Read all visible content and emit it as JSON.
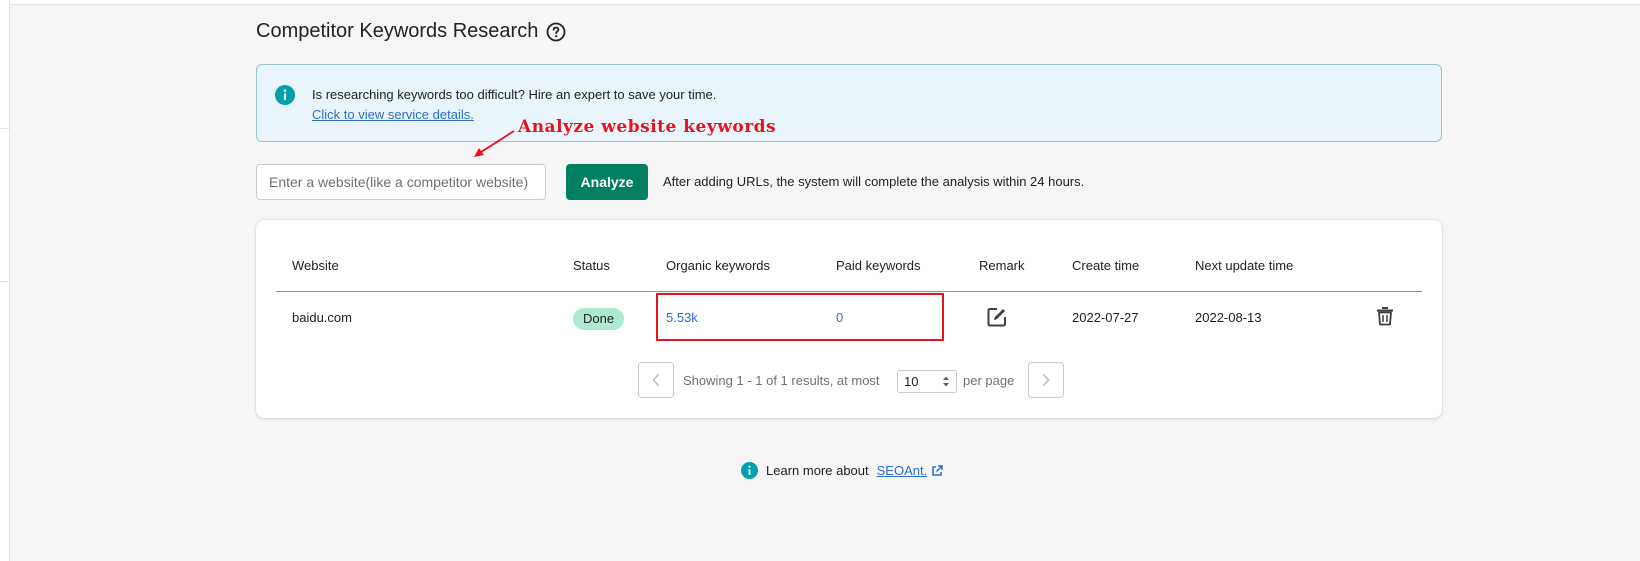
{
  "page": {
    "title": "Competitor Keywords Research"
  },
  "banner": {
    "message": "Is researching keywords too difficult? Hire an expert to save your time.",
    "link_text": "Click to view service details."
  },
  "annotation": {
    "label": "Analyze website keywords",
    "color": "#e8111c"
  },
  "analyze_form": {
    "placeholder": "Enter a website(like a competitor website)",
    "value": "",
    "button_label": "Analyze",
    "note": "After adding URLs, the system will complete the analysis within 24 hours."
  },
  "table": {
    "headers": [
      "Website",
      "Status",
      "Organic keywords",
      "Paid keywords",
      "Remark",
      "Create time",
      "Next update time"
    ],
    "rows": [
      {
        "website": "baidu.com",
        "status": "Done",
        "organic_keywords": "5.53k",
        "paid_keywords": "0",
        "remark_icon": "edit-icon",
        "create_time": "2022-07-27",
        "next_update_time": "2022-08-13",
        "action_icon": "trash-icon"
      }
    ]
  },
  "pagination": {
    "summary": "Showing 1 - 1 of 1 results, at most",
    "per_page_value": "10",
    "per_page_suffix": "per page"
  },
  "footer": {
    "prefix": "Learn more about",
    "link_text": "SEOAnt."
  },
  "colors": {
    "primary_button": "#008060",
    "link": "#2c6ecb",
    "info_icon": "#00a0ac",
    "badge_success": "#aee9d1",
    "highlight": "#e8111c"
  }
}
